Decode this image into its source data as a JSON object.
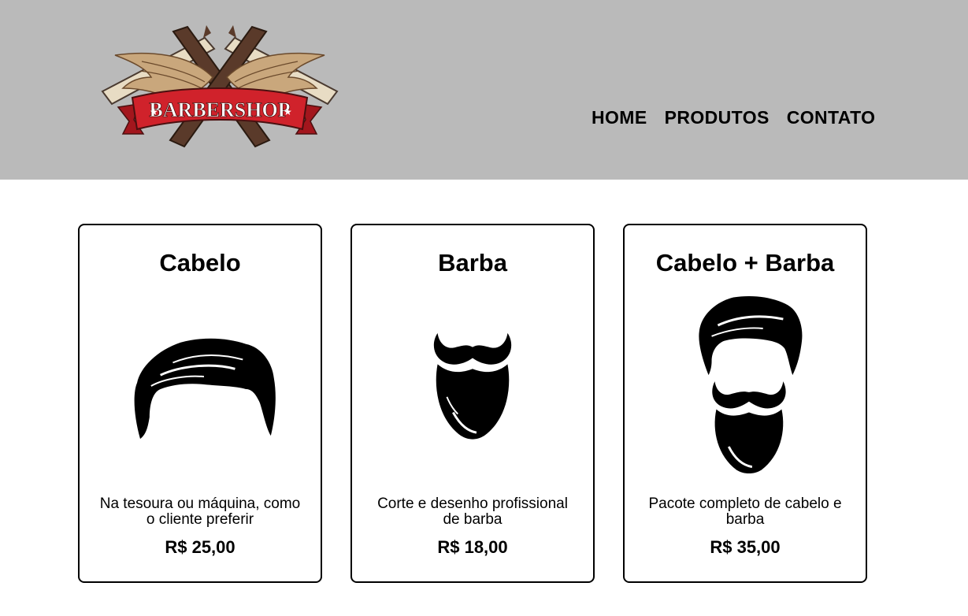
{
  "header": {
    "logo_text": "BARBERSHOP",
    "nav": [
      {
        "label": "HOME"
      },
      {
        "label": "PRODUTOS"
      },
      {
        "label": "CONTATO"
      }
    ]
  },
  "products": [
    {
      "title": "Cabelo",
      "icon": "hair-icon",
      "description": "Na tesoura ou máquina, como o cliente preferir",
      "price": "R$ 25,00"
    },
    {
      "title": "Barba",
      "icon": "beard-icon",
      "description": "Corte e desenho profissional de barba",
      "price": "R$ 18,00"
    },
    {
      "title": "Cabelo + Barba",
      "icon": "hair-and-beard-icon",
      "description": "Pacote completo de cabelo e barba",
      "price": "R$ 35,00"
    }
  ],
  "colors": {
    "header_bg": "#bababa",
    "banner_red": "#d0222b",
    "wing_tan": "#c9a77c",
    "blade_cream": "#e8dcc4",
    "handle_brown": "#5a3a2a"
  }
}
